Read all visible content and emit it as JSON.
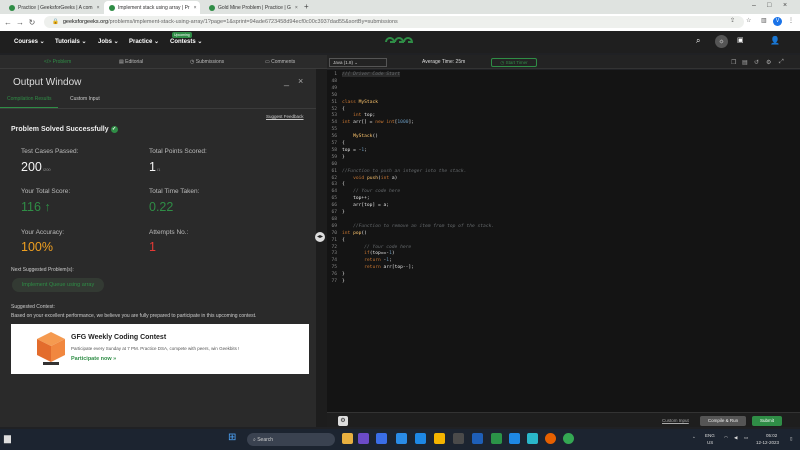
{
  "browser": {
    "tabs": [
      {
        "label": "Practice | GeeksforGeeks | A com",
        "active": false
      },
      {
        "label": "Implement stack using array | Pr",
        "active": true
      },
      {
        "label": "Gold Mine Problem | Practice | G",
        "active": false
      }
    ],
    "new_tab": "+",
    "url_host": "geeksforgeeks.org",
    "url_rest": "/problems/implement-stack-using-array/1?page=1&sprint=94ade6723458d94ecf0c00c3937dad55&sortBy=submissions",
    "profile_initial": "V"
  },
  "site_nav": {
    "items": [
      "Courses",
      "Tutorials",
      "Jobs",
      "Practice",
      "Contests"
    ],
    "badge": "Upcoming",
    "logo": "GfG"
  },
  "problem_tabs": [
    "Problem",
    "Editorial",
    "Submissions",
    "Comments"
  ],
  "output": {
    "title": "Output Window",
    "subtabs": [
      "Compilation Results",
      "Custom Input"
    ],
    "suggest_feedback": "Suggest Feedback",
    "solved_text": "Problem Solved Successfully",
    "test_cases_label": "Test Cases Passed:",
    "test_cases_value": "200",
    "test_cases_total": "/200",
    "points_label": "Total Points Scored:",
    "points_value": "1",
    "points_total": "/1",
    "score_label": "Your Total Score:",
    "score_value": "116",
    "time_label": "Total Time Taken:",
    "time_value": "0.22",
    "accuracy_label": "Your Accuracy:",
    "accuracy_value": "100%",
    "attempts_label": "Attempts No.:",
    "attempts_value": "1",
    "next_label": "Next Suggested Problem(s):",
    "next_problem": "Implement Queue using array",
    "contest_label": "Suggested Contest:",
    "contest_desc": "Based on your excellent performance, we believe you are fully prepared to participate in this upcoming contest.",
    "contest_title": "GFG Weekly Coding Contest",
    "contest_sub": "Participate every Sunday at 7 PM. Practice DSA, compete with peers, win Geekbits !",
    "contest_link": "Participate now »"
  },
  "editor": {
    "language": "Java (1.8)",
    "avg_time": "Average Time: 25m",
    "start_timer": "Start Timer",
    "code": [
      {
        "n": "1",
        "t": "//{ Driver Code Start"
      },
      {
        "n": "48",
        "t": ""
      },
      {
        "n": "49",
        "t": ""
      },
      {
        "n": "50",
        "t": ""
      },
      {
        "n": "51",
        "t": "class MyStack"
      },
      {
        "n": "52",
        "t": "{"
      },
      {
        "n": "53",
        "t": "    int top;"
      },
      {
        "n": "54",
        "t": "int arr[] = new int[1000];"
      },
      {
        "n": "55",
        "t": ""
      },
      {
        "n": "56",
        "t": "    MyStack()"
      },
      {
        "n": "57",
        "t": "{"
      },
      {
        "n": "58",
        "t": "top = -1;"
      },
      {
        "n": "59",
        "t": "}"
      },
      {
        "n": "60",
        "t": ""
      },
      {
        "n": "61",
        "t": "//Function to push an integer into the stack."
      },
      {
        "n": "62",
        "t": "    void push(int a)"
      },
      {
        "n": "63",
        "t": "{"
      },
      {
        "n": "64",
        "t": "    // Your code here"
      },
      {
        "n": "65",
        "t": "    top++;"
      },
      {
        "n": "66",
        "t": "    arr[top] = a;"
      },
      {
        "n": "67",
        "t": "}"
      },
      {
        "n": "68",
        "t": ""
      },
      {
        "n": "69",
        "t": "    //Function to remove an item from top of the stack."
      },
      {
        "n": "70",
        "t": "int pop()"
      },
      {
        "n": "71",
        "t": "{"
      },
      {
        "n": "72",
        "t": "        // Your code here"
      },
      {
        "n": "73",
        "t": "        if(top==-1)"
      },
      {
        "n": "74",
        "t": "        return -1;"
      },
      {
        "n": "75",
        "t": "        return arr[top--];"
      },
      {
        "n": "76",
        "t": "}"
      },
      {
        "n": "77",
        "t": "}"
      }
    ],
    "custom_input": "Custom Input",
    "compile_run": "Compile & Run",
    "submit": "Submit"
  },
  "taskbar": {
    "search": "Search",
    "lang": "ENG",
    "region": "US",
    "time": "05:02",
    "date": "12-12-2023"
  }
}
